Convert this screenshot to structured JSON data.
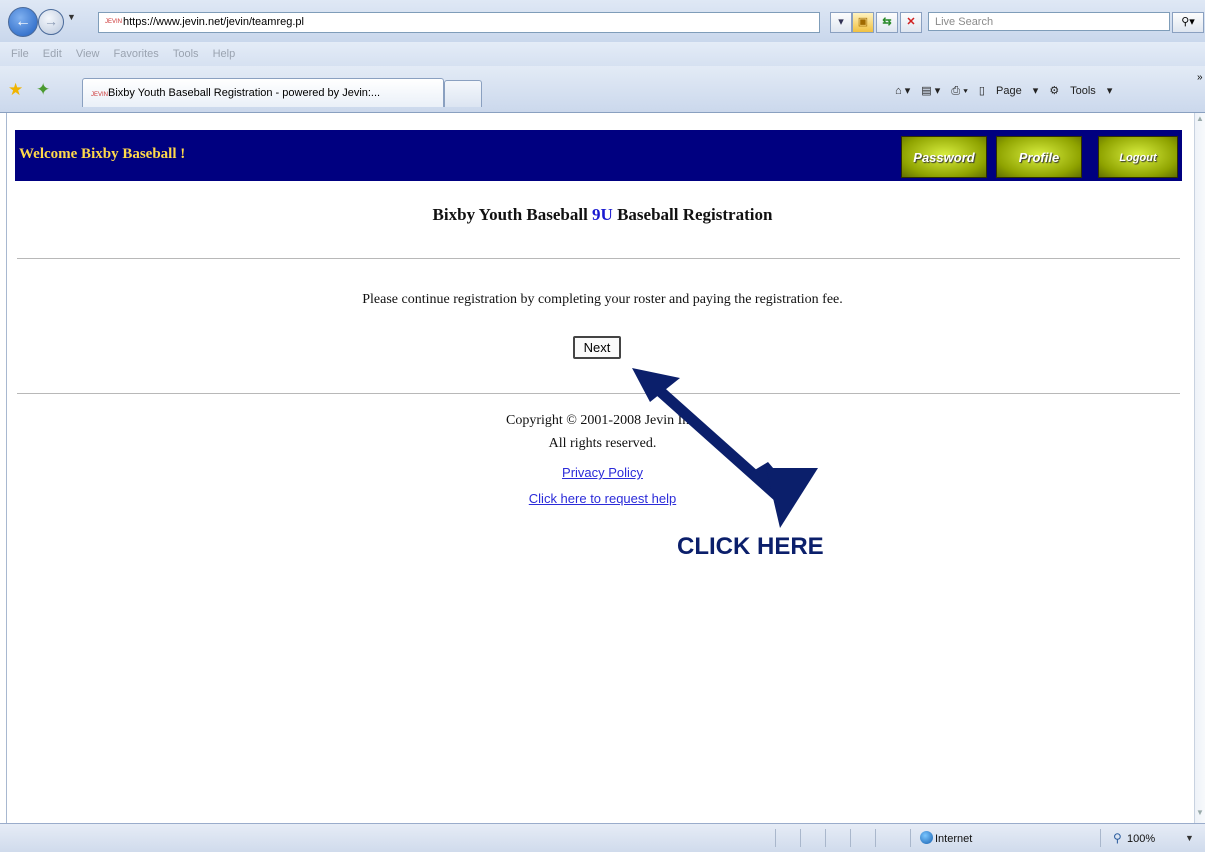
{
  "browser": {
    "url": "https://www.jevin.net/jevin/teamreg.pl",
    "search_placeholder": "Live Search",
    "menu": [
      "File",
      "Edit",
      "View",
      "Favorites",
      "Tools",
      "Help"
    ],
    "tab_title": "Bixby Youth Baseball Registration - powered by Jevin:...",
    "favicon_text": "JEVIN",
    "commands": {
      "page": "Page",
      "tools": "Tools"
    },
    "status": {
      "zone": "Internet",
      "zoom": "100%"
    }
  },
  "header": {
    "welcome": "Welcome Bixby Baseball !",
    "buttons": {
      "password": "Password",
      "profile": "Profile",
      "logout": "Logout"
    },
    "colors": {
      "banner": "#000080",
      "welcome_text": "#ffd94a",
      "button": "#b8cc1a"
    }
  },
  "main": {
    "title_before": "Bixby Youth Baseball ",
    "title_highlight": "9U",
    "title_after": " Baseball Registration",
    "instructions": "Please continue registration by completing your roster and paying the registration fee.",
    "next_label": "Next"
  },
  "footer": {
    "copyright": "Copyright © 2001-2008 Jevin Inc.",
    "rights": "All rights reserved.",
    "privacy": "Privacy Policy",
    "help": "Click here to request help"
  },
  "annotation": {
    "text": "CLICK HERE",
    "color": "#0b1f6b"
  }
}
